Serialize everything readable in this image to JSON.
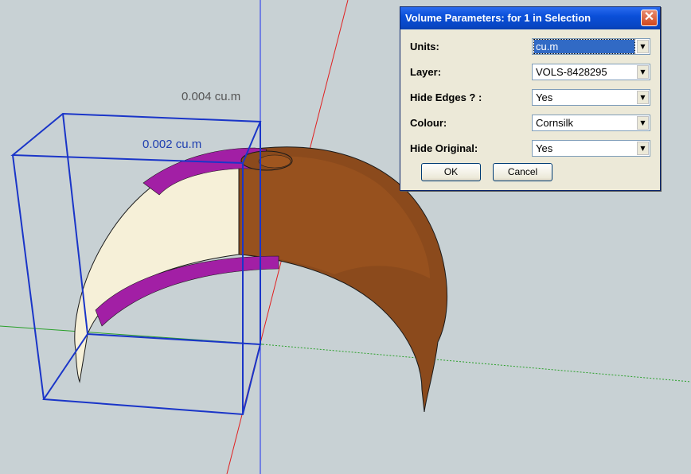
{
  "viewport": {
    "volume_labels": {
      "outer": "0.004 cu.m",
      "inner": "0.002 cu.m"
    }
  },
  "dialog": {
    "title": "Volume Parameters: for 1 in Selection",
    "close_icon": "close-icon",
    "fields": [
      {
        "label": "Units:",
        "value": "cu.m"
      },
      {
        "label": "Layer:",
        "value": "VOLS-8428295"
      },
      {
        "label": "Hide Edges ? :",
        "value": "Yes"
      },
      {
        "label": "Colour:",
        "value": "Cornsilk"
      },
      {
        "label": "Hide Original:",
        "value": "Yes"
      }
    ],
    "ok_label": "OK",
    "cancel_label": "Cancel"
  },
  "colors": {
    "shell_outer": "#8b4513",
    "shell_inner": "#fff8dc",
    "cut_face": "#9b1c9b",
    "bounding_box": "#1a35c8"
  }
}
